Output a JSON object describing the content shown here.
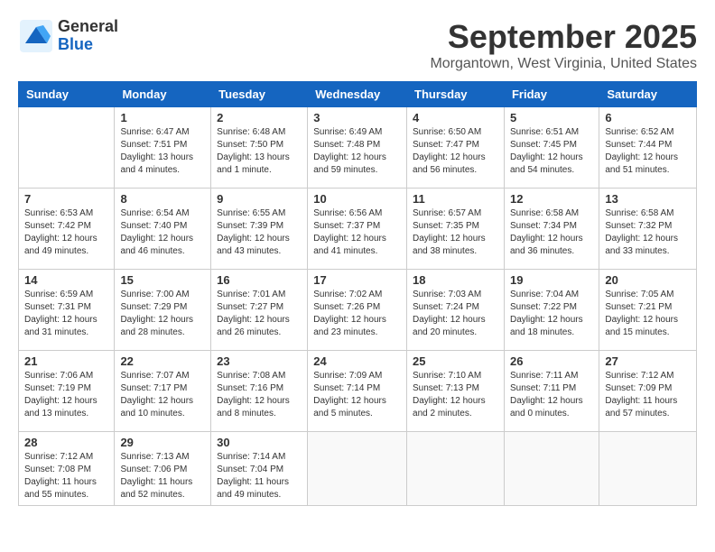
{
  "logo": {
    "general": "General",
    "blue": "Blue"
  },
  "title": "September 2025",
  "location": "Morgantown, West Virginia, United States",
  "weekdays": [
    "Sunday",
    "Monday",
    "Tuesday",
    "Wednesday",
    "Thursday",
    "Friday",
    "Saturday"
  ],
  "weeks": [
    [
      {
        "day": "",
        "info": ""
      },
      {
        "day": "1",
        "info": "Sunrise: 6:47 AM\nSunset: 7:51 PM\nDaylight: 13 hours\nand 4 minutes."
      },
      {
        "day": "2",
        "info": "Sunrise: 6:48 AM\nSunset: 7:50 PM\nDaylight: 13 hours\nand 1 minute."
      },
      {
        "day": "3",
        "info": "Sunrise: 6:49 AM\nSunset: 7:48 PM\nDaylight: 12 hours\nand 59 minutes."
      },
      {
        "day": "4",
        "info": "Sunrise: 6:50 AM\nSunset: 7:47 PM\nDaylight: 12 hours\nand 56 minutes."
      },
      {
        "day": "5",
        "info": "Sunrise: 6:51 AM\nSunset: 7:45 PM\nDaylight: 12 hours\nand 54 minutes."
      },
      {
        "day": "6",
        "info": "Sunrise: 6:52 AM\nSunset: 7:44 PM\nDaylight: 12 hours\nand 51 minutes."
      }
    ],
    [
      {
        "day": "7",
        "info": "Sunrise: 6:53 AM\nSunset: 7:42 PM\nDaylight: 12 hours\nand 49 minutes."
      },
      {
        "day": "8",
        "info": "Sunrise: 6:54 AM\nSunset: 7:40 PM\nDaylight: 12 hours\nand 46 minutes."
      },
      {
        "day": "9",
        "info": "Sunrise: 6:55 AM\nSunset: 7:39 PM\nDaylight: 12 hours\nand 43 minutes."
      },
      {
        "day": "10",
        "info": "Sunrise: 6:56 AM\nSunset: 7:37 PM\nDaylight: 12 hours\nand 41 minutes."
      },
      {
        "day": "11",
        "info": "Sunrise: 6:57 AM\nSunset: 7:35 PM\nDaylight: 12 hours\nand 38 minutes."
      },
      {
        "day": "12",
        "info": "Sunrise: 6:58 AM\nSunset: 7:34 PM\nDaylight: 12 hours\nand 36 minutes."
      },
      {
        "day": "13",
        "info": "Sunrise: 6:58 AM\nSunset: 7:32 PM\nDaylight: 12 hours\nand 33 minutes."
      }
    ],
    [
      {
        "day": "14",
        "info": "Sunrise: 6:59 AM\nSunset: 7:31 PM\nDaylight: 12 hours\nand 31 minutes."
      },
      {
        "day": "15",
        "info": "Sunrise: 7:00 AM\nSunset: 7:29 PM\nDaylight: 12 hours\nand 28 minutes."
      },
      {
        "day": "16",
        "info": "Sunrise: 7:01 AM\nSunset: 7:27 PM\nDaylight: 12 hours\nand 26 minutes."
      },
      {
        "day": "17",
        "info": "Sunrise: 7:02 AM\nSunset: 7:26 PM\nDaylight: 12 hours\nand 23 minutes."
      },
      {
        "day": "18",
        "info": "Sunrise: 7:03 AM\nSunset: 7:24 PM\nDaylight: 12 hours\nand 20 minutes."
      },
      {
        "day": "19",
        "info": "Sunrise: 7:04 AM\nSunset: 7:22 PM\nDaylight: 12 hours\nand 18 minutes."
      },
      {
        "day": "20",
        "info": "Sunrise: 7:05 AM\nSunset: 7:21 PM\nDaylight: 12 hours\nand 15 minutes."
      }
    ],
    [
      {
        "day": "21",
        "info": "Sunrise: 7:06 AM\nSunset: 7:19 PM\nDaylight: 12 hours\nand 13 minutes."
      },
      {
        "day": "22",
        "info": "Sunrise: 7:07 AM\nSunset: 7:17 PM\nDaylight: 12 hours\nand 10 minutes."
      },
      {
        "day": "23",
        "info": "Sunrise: 7:08 AM\nSunset: 7:16 PM\nDaylight: 12 hours\nand 8 minutes."
      },
      {
        "day": "24",
        "info": "Sunrise: 7:09 AM\nSunset: 7:14 PM\nDaylight: 12 hours\nand 5 minutes."
      },
      {
        "day": "25",
        "info": "Sunrise: 7:10 AM\nSunset: 7:13 PM\nDaylight: 12 hours\nand 2 minutes."
      },
      {
        "day": "26",
        "info": "Sunrise: 7:11 AM\nSunset: 7:11 PM\nDaylight: 12 hours\nand 0 minutes."
      },
      {
        "day": "27",
        "info": "Sunrise: 7:12 AM\nSunset: 7:09 PM\nDaylight: 11 hours\nand 57 minutes."
      }
    ],
    [
      {
        "day": "28",
        "info": "Sunrise: 7:12 AM\nSunset: 7:08 PM\nDaylight: 11 hours\nand 55 minutes."
      },
      {
        "day": "29",
        "info": "Sunrise: 7:13 AM\nSunset: 7:06 PM\nDaylight: 11 hours\nand 52 minutes."
      },
      {
        "day": "30",
        "info": "Sunrise: 7:14 AM\nSunset: 7:04 PM\nDaylight: 11 hours\nand 49 minutes."
      },
      {
        "day": "",
        "info": ""
      },
      {
        "day": "",
        "info": ""
      },
      {
        "day": "",
        "info": ""
      },
      {
        "day": "",
        "info": ""
      }
    ]
  ]
}
